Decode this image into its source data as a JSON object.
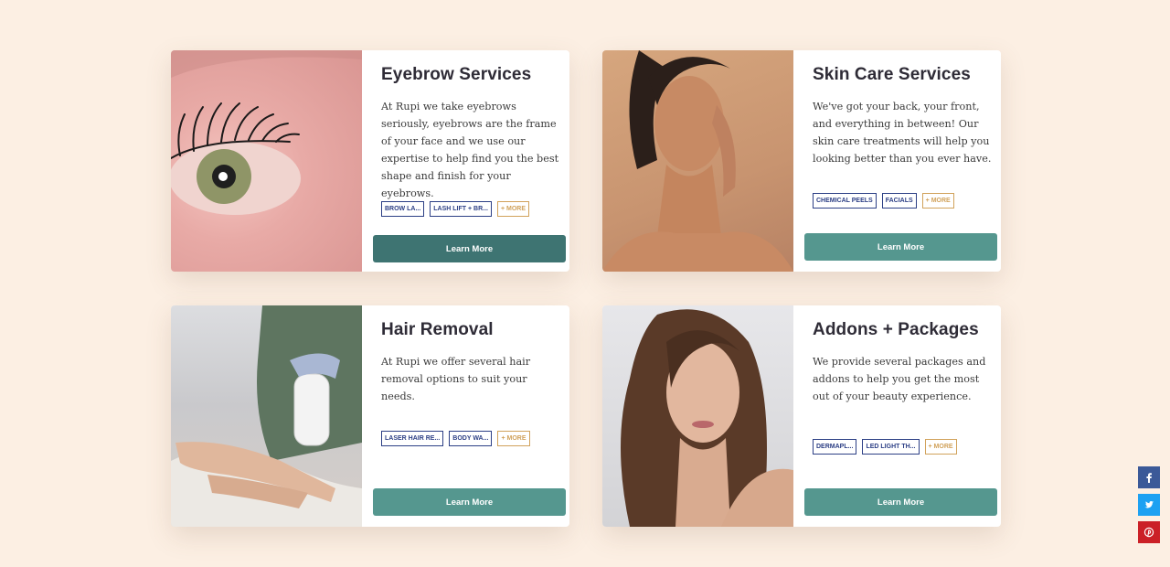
{
  "cards": [
    {
      "title": "Eyebrow Services",
      "description": "At Rupi we take eyebrows seriously, eyebrows are the frame of your face and we use our expertise to help find you the best shape and finish for your eyebrows.",
      "tags": [
        "BROW LA...",
        "LASH LIFT + BR..."
      ],
      "more_label": "+ MORE",
      "button_label": "Learn More"
    },
    {
      "title": "Skin Care Services",
      "description": "We've got your back, your front, and everything in between! Our skin care treatments will help you looking better than you ever have.",
      "tags": [
        "CHEMICAL PEELS",
        "FACIALS"
      ],
      "more_label": "+ MORE",
      "button_label": "Learn More"
    },
    {
      "title": "Hair Removal",
      "description": "At Rupi we offer several hair removal options to suit your needs.",
      "tags": [
        "LASER HAIR RE...",
        "BODY WA..."
      ],
      "more_label": "+ MORE",
      "button_label": "Learn More"
    },
    {
      "title": "Addons + Packages",
      "description": "We provide several packages and addons to help you get the most out of your beauty experience.",
      "tags": [
        "DERMAPL...",
        "LED LIGHT TH..."
      ],
      "more_label": "+ MORE",
      "button_label": "Learn More"
    }
  ],
  "social": [
    {
      "icon": "facebook-icon",
      "color": "#3b5998"
    },
    {
      "icon": "twitter-icon",
      "color": "#1da1f2"
    },
    {
      "icon": "pinterest-icon",
      "color": "#cb2027"
    }
  ],
  "colors": {
    "background": "#fcefe3",
    "button": "#55978f",
    "button_active": "#3e7472",
    "tag": "#2c3f85",
    "tag_more": "#d1a25b"
  }
}
